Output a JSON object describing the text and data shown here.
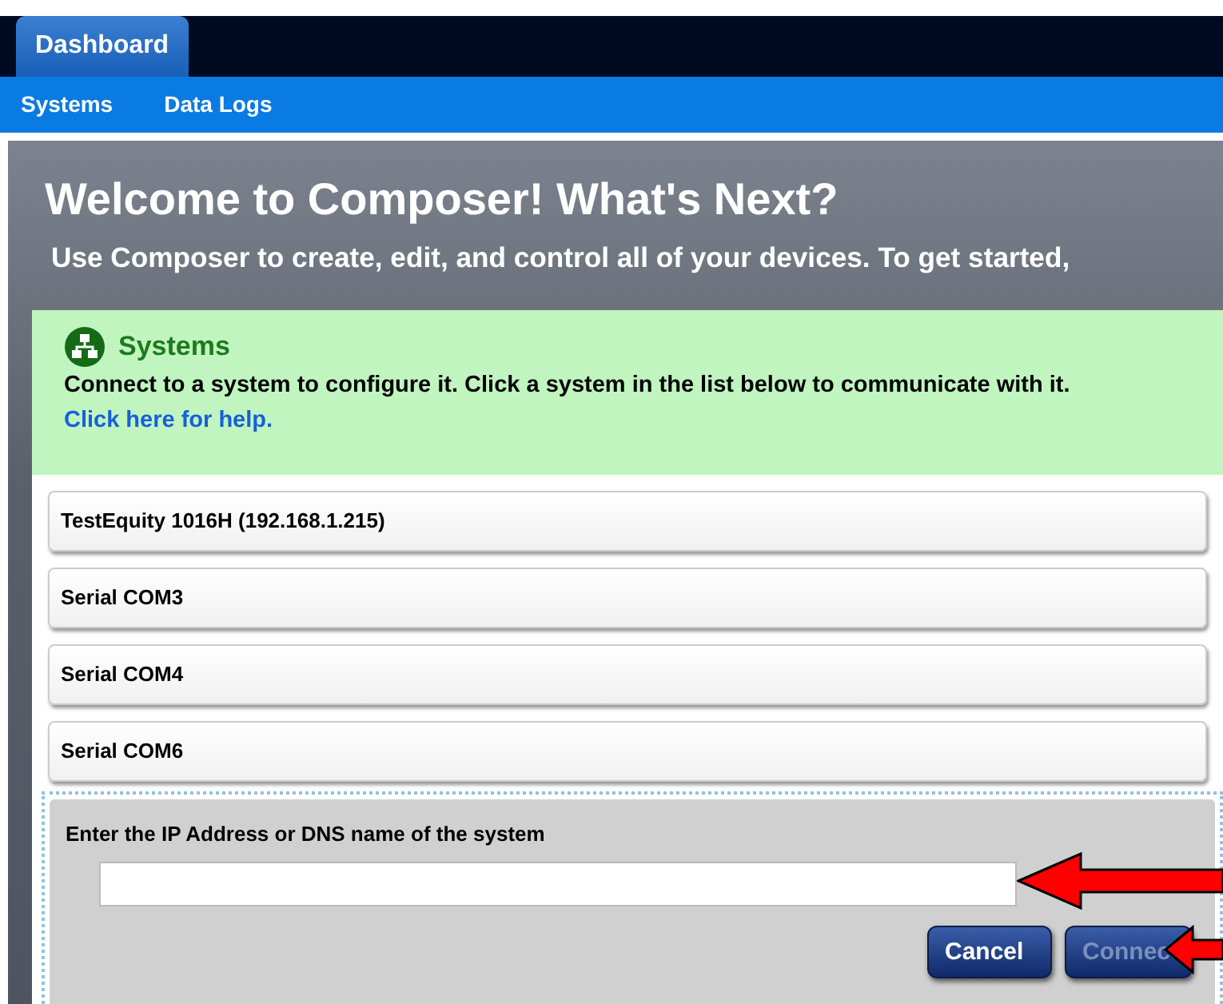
{
  "tabs": [
    {
      "label": "Dashboard",
      "selected": true
    }
  ],
  "nav": [
    {
      "label": "Systems"
    },
    {
      "label": "Data Logs"
    }
  ],
  "title": "Welcome to Composer! What's Next?",
  "subtitle": "Use Composer to create, edit, and control all of your devices. To get started,",
  "systems_panel": {
    "heading": "Systems",
    "description": "Connect to a system to configure it. Click a system in the list below to communicate with it.",
    "help_link": "Click here for help.",
    "systems": [
      {
        "label": "TestEquity 1016H (192.168.1.215)"
      },
      {
        "label": "Serial COM3"
      },
      {
        "label": "Serial COM4"
      },
      {
        "label": "Serial COM6"
      }
    ],
    "connect_form": {
      "label": "Enter the IP Address or DNS name of the system",
      "buttons": [
        {
          "label": "Cancel",
          "disabled": false
        },
        {
          "label": "Connec",
          "disabled": true
        }
      ]
    }
  }
}
